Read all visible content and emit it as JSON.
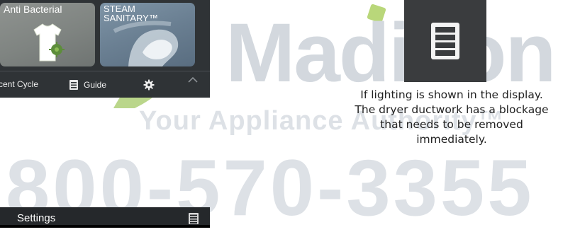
{
  "panel": {
    "tiles": [
      {
        "label": "Anti Bacterial",
        "icon": "shirt-icon"
      },
      {
        "label": "STEAM SANITARY™",
        "icon": "steam-hand-icon"
      }
    ],
    "bar": {
      "recent_label": "cent Cycle",
      "guide_label": "Guide",
      "guide_icon": "document-icon",
      "settings_icon": "gear-icon",
      "expand_icon": "chevron-up-icon"
    }
  },
  "indicator": {
    "icon": "ductwork-blockage-icon",
    "note": "If lighting is shown in the display. The dryer ductwork has a blockage that needs to be removed immediately."
  },
  "settings_bar": {
    "label": "Settings",
    "icon": "ductwork-blockage-icon"
  },
  "watermark": {
    "brand": "Madison",
    "tagline": "Your Appliance Authority™",
    "phone": "800-570-3355"
  },
  "colors": {
    "panel_bg": "#2f3336",
    "watermark_gray": "#d3d8de",
    "watermark_green": "#9cc35a",
    "text": "#222222"
  }
}
